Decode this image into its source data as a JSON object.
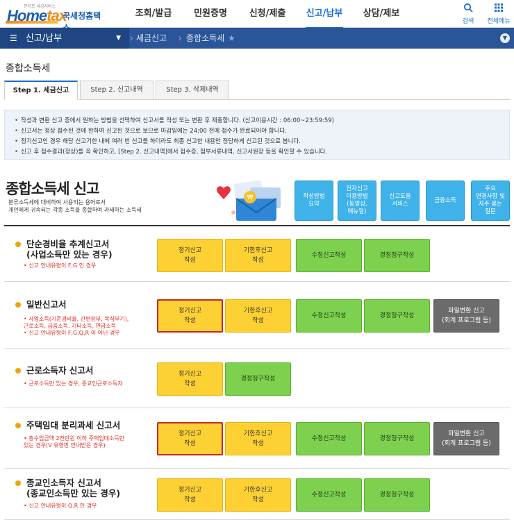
{
  "header": {
    "logo_tagline": "전자로 세금서비스",
    "logo_text_a": "Home",
    "logo_text_b": "tax",
    "logo_korean": "국세청홈택스",
    "nav": [
      "조회/발급",
      "민원증명",
      "신청/제출",
      "신고/납부",
      "상담/제보"
    ],
    "active_nav": "신고/납부",
    "search_label": "검색",
    "menu_label": "전체메뉴"
  },
  "breadcrumb": {
    "home": "신고/납부",
    "items": [
      "세금신고",
      "종합소득세"
    ],
    "star": "★"
  },
  "page": {
    "title": "종합소득세",
    "tabs": [
      "Step 1. 세금신고",
      "Step 2. 신고내역",
      "Step 3. 삭제내역"
    ]
  },
  "notice": [
    "작성과 변환 신고 중에서 원하는 방법을 선택하여 신고서를 작성 또는 변환 후 제출합니다. (신고이용시간 : 06:00~23:59:59)",
    "신고서는 정상 접수된 것에 한하여 신고된 것으로 보므로 마감일에는 24:00 전에 접수가 완료되어야 합니다.",
    "정기신고인 경우 해당 신고기한 내에 여러 번 신고를 하더라도 최종 신고한 내용만 정당하게 신고된 것으로 봅니다.",
    "신고 후 접수결과(정상)를 꼭 확인하고, [Step 2. 신고내역]에서 접수증, 첨부서류내역, 신고서원장 등을 확인할 수 있습니다."
  ],
  "section": {
    "title": "종합소득세 신고",
    "desc_line1": "분류소득세에 대비하여 사용되는 용어로서",
    "desc_line2": "개인에게 귀속되는 각종 소득을 종합하여 과세하는 소득세",
    "quick_buttons": [
      "작성방법\n요약",
      "전자신고\n이용방법\n(동영상,\n매뉴얼)",
      "신고도움\n서비스",
      "금융소득",
      "주요\n변경사항 및\n자주 묻는\n질문"
    ]
  },
  "rows": [
    {
      "title": "단순경비율 추계신고서\n(사업소득만 있는 경우)",
      "notes": [
        "신고 안내유형이 F,G 인 경우"
      ],
      "buttons": [
        {
          "label": "정기신고\n작성",
          "style": "y",
          "selected": false
        },
        {
          "label": "기한후신고\n작성",
          "style": "y",
          "selected": false
        },
        {
          "label": "수정신고작성",
          "style": "g",
          "selected": false
        },
        {
          "label": "경정청구작성",
          "style": "g",
          "selected": false
        }
      ]
    },
    {
      "title": "일반신고서",
      "notes": [
        "사업소득(기준경비율, 간편장부, 복식부기),\n근로소득, 금융소득, 기타소득, 연금소득",
        "신고 안내유형이 F,G,Q,R 이 아닌 경우"
      ],
      "buttons": [
        {
          "label": "정기신고\n작성",
          "style": "y",
          "selected": true
        },
        {
          "label": "기한후신고\n작성",
          "style": "y",
          "selected": false
        },
        {
          "label": "수정신고작성",
          "style": "g",
          "selected": false
        },
        {
          "label": "경정청구작성",
          "style": "g",
          "selected": false
        },
        {
          "label": "파일변환 신고\n(회계 프로그램 등)",
          "style": "d",
          "selected": false
        }
      ]
    },
    {
      "title": "근로소득자 신고서",
      "notes": [
        "근로소득만 있는 경우, 종교인근로소득자"
      ],
      "buttons": [
        {
          "label": "정기신고\n작성",
          "style": "y",
          "selected": false
        },
        {
          "label": "경정청구작성",
          "style": "g",
          "selected": false
        }
      ]
    },
    {
      "title": "주택임대 분리과세 신고서",
      "notes": [
        "총수입금액 2천만원 이하 주택임대소득만\n있는 경우(V 유형만 안내받은 경우)"
      ],
      "buttons": [
        {
          "label": "정기신고\n작성",
          "style": "y",
          "selected": true
        },
        {
          "label": "기한후신고\n작성",
          "style": "y",
          "selected": false
        },
        {
          "label": "수정신고작성",
          "style": "g",
          "selected": false
        },
        {
          "label": "경정청구작성",
          "style": "g",
          "selected": false
        },
        {
          "label": "파일변환 신고\n(회계 프로그램 등)",
          "style": "d",
          "selected": false
        }
      ]
    },
    {
      "title": "종교인소득자 신고서\n(종교인소득만 있는 경우)",
      "notes": [
        "신고 안내유형이 Q,R 인 경우"
      ],
      "buttons": [
        {
          "label": "정기신고\n작성",
          "style": "y",
          "selected": false
        },
        {
          "label": "기한후신고\n작성",
          "style": "y",
          "selected": false
        },
        {
          "label": "수정신고작성",
          "style": "g",
          "selected": false
        },
        {
          "label": "경정청구작성",
          "style": "g",
          "selected": false
        }
      ]
    }
  ]
}
